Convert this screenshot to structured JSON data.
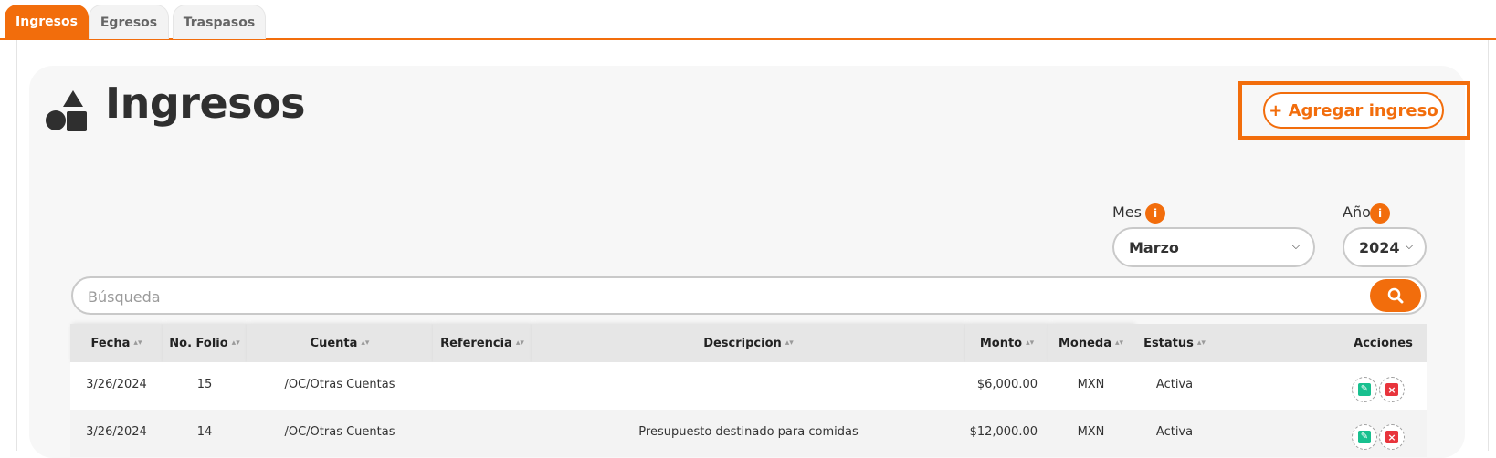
{
  "tabs": [
    {
      "label": "Ingresos",
      "active": true
    },
    {
      "label": "Egresos",
      "active": false
    },
    {
      "label": "Traspasos",
      "active": false
    }
  ],
  "page": {
    "title": "Ingresos",
    "icon": "shapes-icon",
    "add_button": "+ Agregar ingreso"
  },
  "filters": {
    "month_label": "Mes",
    "month_value": "Marzo",
    "year_label": "Año",
    "year_value": "2024",
    "info_glyph": "i"
  },
  "search": {
    "placeholder": "Búsqueda",
    "value": ""
  },
  "table": {
    "columns": [
      "Fecha",
      "No. Folio",
      "Cuenta",
      "Referencia",
      "Descripcion",
      "Monto",
      "Moneda",
      "Estatus",
      "Acciones"
    ],
    "rows": [
      {
        "fecha": "3/26/2024",
        "folio": "15",
        "cuenta": "/OC/Otras Cuentas",
        "referencia": "",
        "descripcion": "",
        "monto": "$6,000.00",
        "moneda": "MXN",
        "estatus": "Activa"
      },
      {
        "fecha": "3/26/2024",
        "folio": "14",
        "cuenta": "/OC/Otras Cuentas",
        "referencia": "",
        "descripcion": "Presupuesto destinado para comidas",
        "monto": "$12,000.00",
        "moneda": "MXN",
        "estatus": "Activa"
      }
    ]
  },
  "colors": {
    "accent": "#f26d0c",
    "edit": "#18c08f",
    "delete": "#e8343c"
  }
}
